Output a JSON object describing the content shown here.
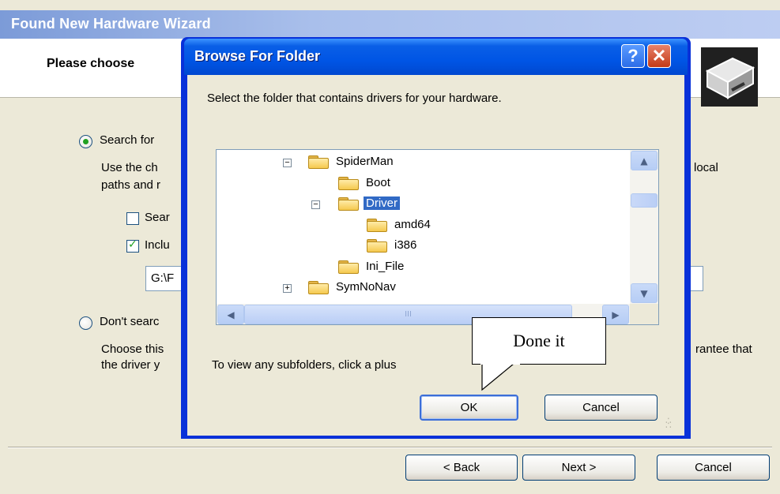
{
  "wizard": {
    "title": "Found New Hardware Wizard",
    "heading": "Please choose",
    "radio_search_label": "Search for",
    "search_desc_line1": "Use the ch",
    "search_desc_line1_right": "local",
    "search_desc_line2": "paths and r",
    "check_search_label": "Sear",
    "check_include_label": "Inclu",
    "path_value": "G:\\F",
    "radio_dont_label": "Don't searc",
    "dont_desc_line1": "Choose this",
    "dont_desc_line1_right": "rantee that",
    "dont_desc_line2": "the driver y",
    "back_label": "< Back",
    "next_label": "Next >",
    "cancel_label": "Cancel"
  },
  "dialog": {
    "title": "Browse For Folder",
    "help_label": "?",
    "close_label": "✕",
    "prompt": "Select the folder that contains drivers for your hardware.",
    "hint": "To view any subfolders, click a plus",
    "ok_label": "OK",
    "cancel_label": "Cancel",
    "hscroll_grip": "III",
    "tree": [
      {
        "label": "SpiderMan",
        "expander": "−",
        "level": 1,
        "selected": false
      },
      {
        "label": "Boot",
        "expander": "",
        "level": 2,
        "selected": false
      },
      {
        "label": "Driver",
        "expander": "−",
        "level": 2,
        "selected": true
      },
      {
        "label": "amd64",
        "expander": "",
        "level": 3,
        "selected": false
      },
      {
        "label": "i386",
        "expander": "",
        "level": 3,
        "selected": false
      },
      {
        "label": "Ini_File",
        "expander": "",
        "level": 2,
        "selected": false
      },
      {
        "label": "SymNoNav",
        "expander": "+",
        "level": 1,
        "selected": false
      }
    ]
  },
  "callout": {
    "text": "Done it"
  },
  "colors": {
    "dialog_title_blue": "#0055E5",
    "selection_blue": "#316AC5",
    "wizard_bg": "#ECE9D8"
  }
}
